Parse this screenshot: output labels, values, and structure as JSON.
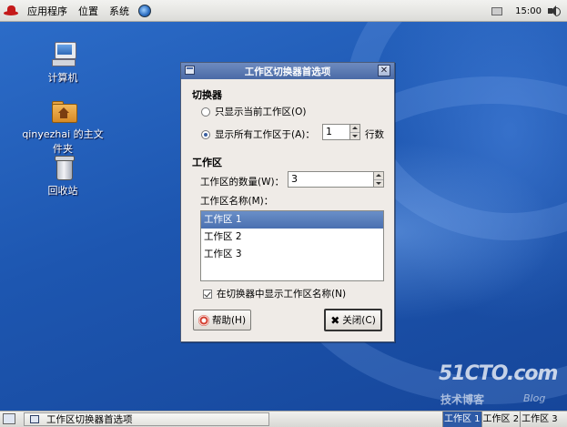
{
  "top_panel": {
    "menus": [
      "应用程序",
      "位置",
      "系统"
    ],
    "clock": "15:00"
  },
  "desktop": {
    "icons": [
      {
        "label": "计算机",
        "icon": "computer-icon"
      },
      {
        "label": "qinyezhai 的主文件夹",
        "icon": "home-folder-icon"
      },
      {
        "label": "回收站",
        "icon": "trash-icon"
      }
    ],
    "watermark": {
      "brand": "51CTO.com",
      "sub": "技术博客",
      "blog": "Blog"
    }
  },
  "dialog": {
    "title": "工作区切换器首选项",
    "switcher_section": "切换器",
    "radio_current": "只显示当前工作区(O)",
    "radio_all": "显示所有工作区于(A)：",
    "rows_value": "1",
    "rows_label": "行数",
    "workspaces_section": "工作区",
    "count_label": "工作区的数量(W)：",
    "count_value": "3",
    "names_label": "工作区名称(M)：",
    "workspace_names": [
      "工作区 1",
      "工作区 2",
      "工作区 3"
    ],
    "show_names_checkbox": "在切换器中显示工作区名称(N)",
    "help_button": "帮助(H)",
    "close_button": "关闭(C)"
  },
  "bottom_panel": {
    "task": "工作区切换器首选项",
    "workspaces": [
      "工作区 1",
      "工作区 2",
      "工作区 3"
    ]
  }
}
